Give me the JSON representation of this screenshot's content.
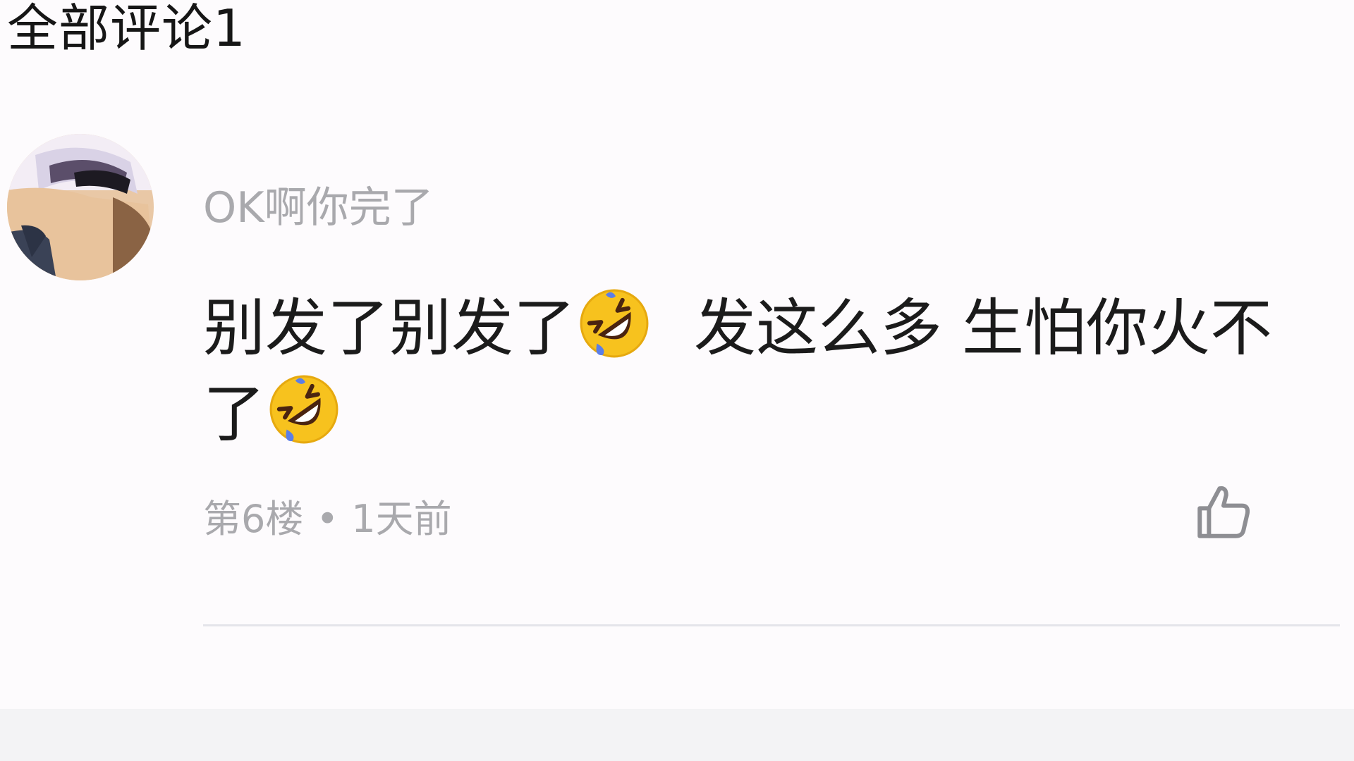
{
  "header": {
    "title": "全部评论1"
  },
  "comment": {
    "username": "OK啊你完了",
    "avatar_icon": "avatar-image",
    "body_parts": [
      "别发了别发了",
      "发这么多 生怕你火不了"
    ],
    "emoji_icon": "rolling-on-floor-laughing-emoji",
    "floor": "第6楼",
    "separator": "•",
    "time": "1天前",
    "like_icon": "thumbs-up-icon"
  },
  "colors": {
    "background": "#fdfbfd",
    "secondary_text": "#a9a9ad",
    "primary_text": "#1b1b1b",
    "divider": "#e4e4ea"
  }
}
